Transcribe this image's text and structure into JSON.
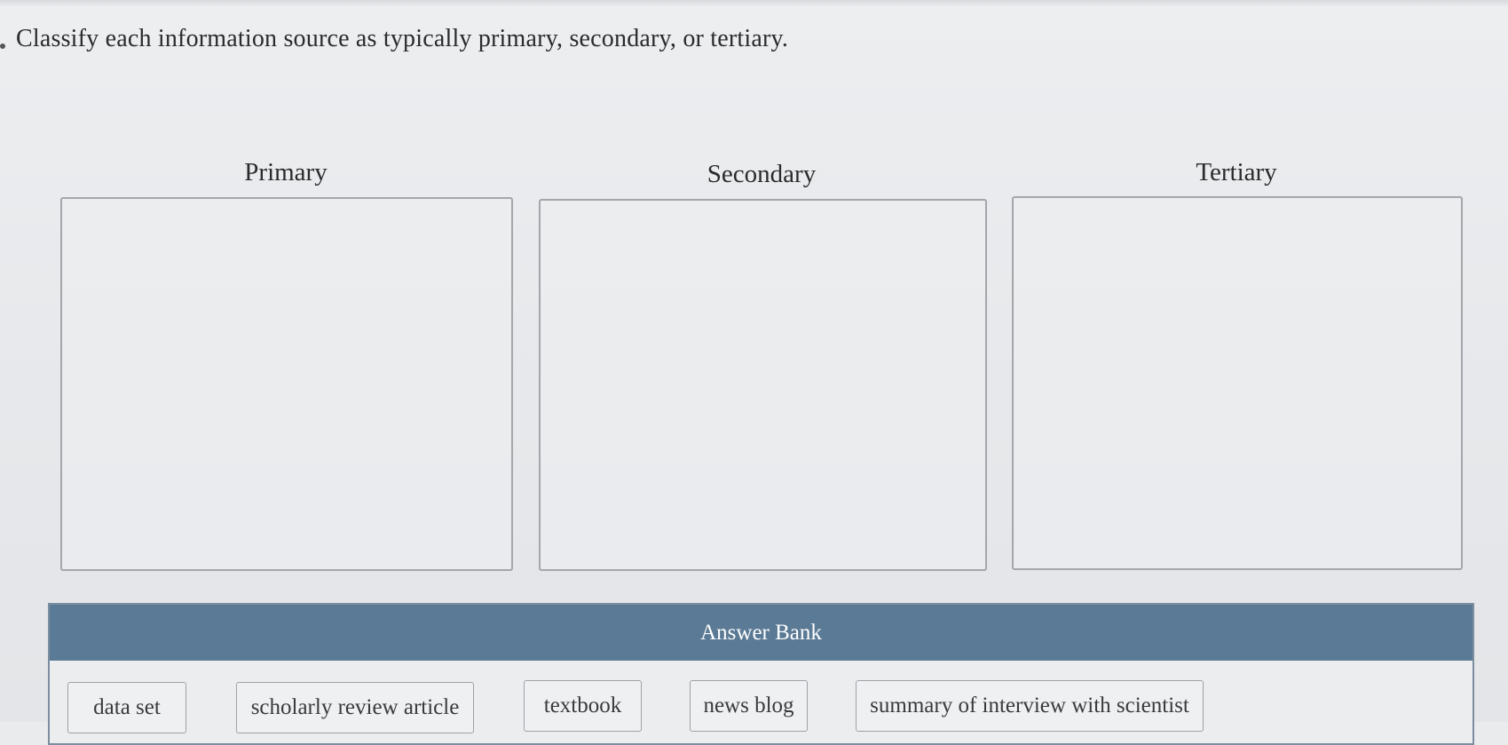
{
  "instruction": "Classify each information source as typically primary, secondary, or tertiary.",
  "categories": [
    {
      "label": "Primary"
    },
    {
      "label": "Secondary"
    },
    {
      "label": "Tertiary"
    }
  ],
  "answer_bank": {
    "title": "Answer Bank",
    "items": [
      {
        "label": "data set"
      },
      {
        "label": "scholarly review article"
      },
      {
        "label": "textbook"
      },
      {
        "label": "news blog"
      },
      {
        "label": "summary of interview with scientist"
      }
    ]
  },
  "colors": {
    "header_bg": "#5a7a95",
    "header_text": "#ffffff",
    "zone_border": "#a3a6aa",
    "page_bg": "#e9ebed"
  }
}
